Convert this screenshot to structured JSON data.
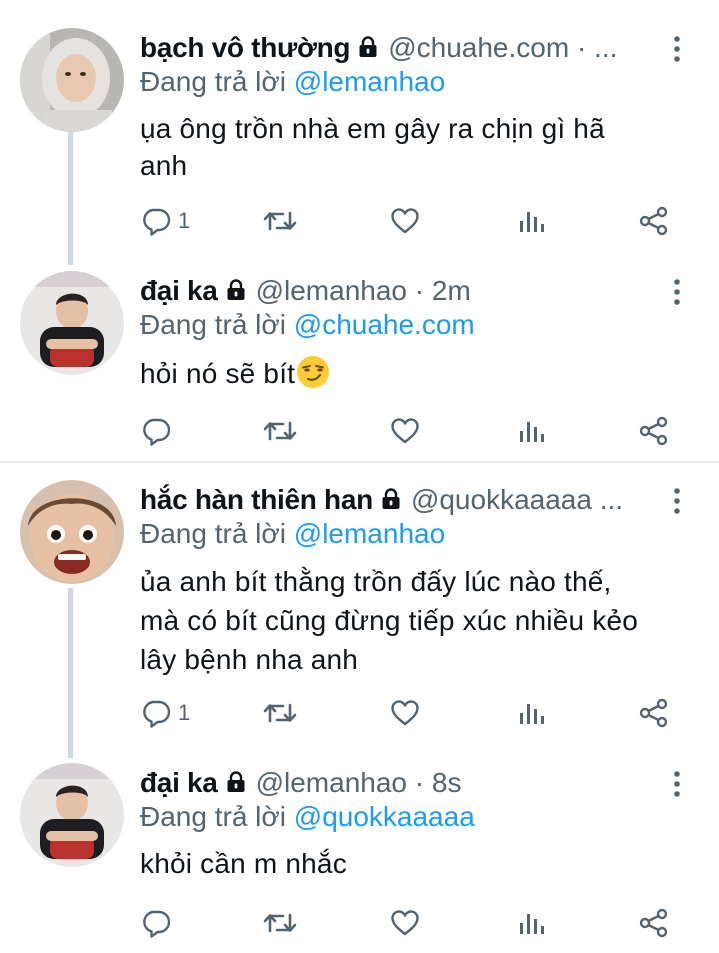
{
  "replying_prefix": "Đang trả lời",
  "colors": {
    "text": "#0f1419",
    "secondary": "#536471",
    "accent": "#1d9bf0",
    "divider": "#e7e9ea",
    "thread_line": "#cfd9de"
  },
  "tweets": [
    {
      "name": "bạch vô thường",
      "handle_meta": "@chuahe.com · ...",
      "reply_to": "@lemanhao",
      "text_lines": [
        "ụa ông trồn nhà em gây ra chịn gì hã",
        "anh"
      ],
      "reply_count": "1",
      "avatar_icon": "avatar-hoodie-photo"
    },
    {
      "name": "đại ka",
      "handle_meta": "@lemanhao · 2m",
      "reply_to": "@chuahe.com",
      "text_lines": [
        "hỏi nó sẽ bít"
      ],
      "reply_count": "",
      "avatar_icon": "avatar-sitting-photo"
    },
    {
      "name": "hắc hàn thiên han",
      "handle_meta": "@quokkaaaaa ...",
      "reply_to": "@lemanhao",
      "text_lines": [
        "ủa anh bít thằng trồn đấy lúc nào thế,",
        "mà có bít cũng đừng tiếp xúc nhiều kẻo",
        "lây bệnh nha anh"
      ],
      "reply_count": "1",
      "avatar_icon": "avatar-closeup-photo"
    },
    {
      "name": "đại ka",
      "handle_meta": "@lemanhao · 8s",
      "reply_to": "@quokkaaaaa",
      "text_lines": [
        "khỏi cần m nhắc"
      ],
      "reply_count": "",
      "avatar_icon": "avatar-sitting-photo"
    }
  ]
}
